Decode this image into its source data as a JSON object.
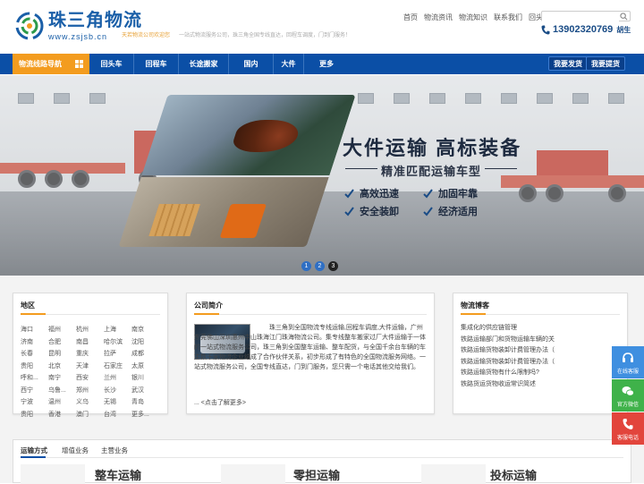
{
  "header": {
    "logo_cn": "珠三角物流",
    "logo_en": "www.zsjsb.cn",
    "welcome": "天若物流公司欢迎您",
    "slogan": "一站式物流服务公司，珠三角全国专线直达，回程车调度，门到门服务！",
    "top_links": [
      "首页",
      "物流资讯",
      "物流知识",
      "联系我们",
      "回头车"
    ],
    "search_placeholder": "",
    "phone": "13902320769",
    "phone_name": "胡生"
  },
  "nav": {
    "main_label": "物流线路导航",
    "items": [
      "回头车",
      "回程车",
      "长途搬家",
      "国内",
      "大件",
      "更多"
    ],
    "btn_shipper": "我要发货",
    "btn_carrier": "我要提货"
  },
  "banner": {
    "title": "大件运输  高标装备",
    "subtitle": "精准匹配运输车型",
    "features": [
      "高效迅速",
      "加固牢靠",
      "安全装卸",
      "经济适用"
    ],
    "dots": [
      "1",
      "2",
      "3"
    ],
    "active_dot": 3
  },
  "region_box": {
    "title": "地区",
    "regions": [
      "海口",
      "福州",
      "杭州",
      "上海",
      "南京",
      "济南",
      "合肥",
      "南昌",
      "哈尔滨",
      "沈阳",
      "长春",
      "昆明",
      "重庆",
      "拉萨",
      "成都",
      "贵阳",
      "北京",
      "天津",
      "石家庄",
      "太原",
      "呼和...",
      "南宁",
      "西安",
      "兰州",
      "银川",
      "西宁",
      "乌鲁...",
      "郑州",
      "长沙",
      "武汉",
      "宁波",
      "温州",
      "义乌",
      "无锡",
      "青岛",
      "贵阳",
      "香港",
      "澳门",
      "台湾",
      "更多..."
    ]
  },
  "about_box": {
    "title": "公司简介",
    "text": "珠三角到全国物流专线运输,回程车调度,大件运输，广州东莞佛山深圳惠州中山珠海江门珠海物流公司。集专线整车搬家过厂大件运输于一体的一站式物流服务公司，珠三角到全国整车运输、整车配货，与全国千余台车辆的车主数千家物流企业结成了合作伙伴关系，初步形成了有特色的全国物流服务网络。一站式物流服务公司，全国专线直达，门到门服务，您只需一个电话其他交给我们。",
    "more": "... <点击了解更多>"
  },
  "news_box": {
    "title": "物流博客",
    "items": [
      "集成化的供应链管理",
      "铁路运输部门和货物运输车辆的关",
      "铁路运输货物装卸计费管理办法（",
      "铁路运输货物装卸计费管理办法（",
      "铁路运输货物有什么限制吗?",
      "铁路货运货物收运常识简述"
    ]
  },
  "bottom": {
    "tabs": [
      "运输方式",
      "增值业务",
      "主营业务"
    ],
    "cards": [
      "整车运输",
      "零担运输",
      "投标运输"
    ]
  },
  "float_bar": {
    "items": [
      "在线客服",
      "官方微信",
      "客服电话"
    ],
    "colors": [
      "#3f8fe0",
      "#3fb24a",
      "#e2453c"
    ]
  },
  "colors": {
    "nav_blue": "#0b4fa6",
    "accent_orange": "#f39c1f",
    "phone_blue": "#1a4c86"
  }
}
